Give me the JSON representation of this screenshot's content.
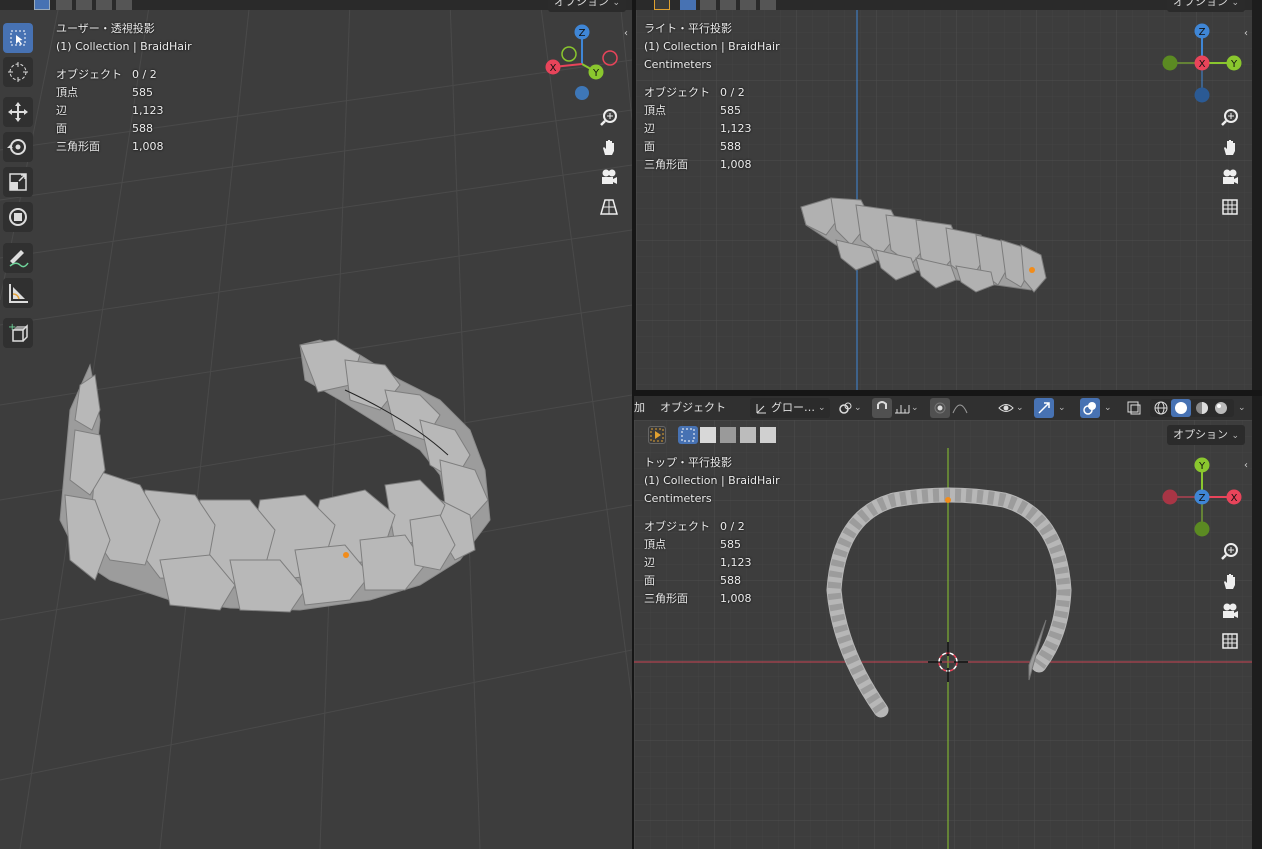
{
  "viewport_left": {
    "view_name": "ユーザー・透視投影",
    "collection": "(1) Collection | BraidHair",
    "options_label": "オプション"
  },
  "viewport_right_top": {
    "view_name": "ライト・平行投影",
    "collection": "(1) Collection | BraidHair",
    "units": "Centimeters",
    "options_label": "オプション"
  },
  "viewport_right_bottom": {
    "view_name": "トップ・平行投影",
    "collection": "(1) Collection | BraidHair",
    "units": "Centimeters",
    "options_label": "オプション"
  },
  "stats": {
    "objects_label": "オブジェクト",
    "objects_value": "0 / 2",
    "vertices_label": "頂点",
    "vertices_value": "585",
    "edges_label": "辺",
    "edges_value": "1,123",
    "faces_label": "面",
    "faces_value": "588",
    "triangles_label": "三角形面",
    "triangles_value": "1,008"
  },
  "header": {
    "add_menu": "加",
    "object_menu": "オブジェクト",
    "transform_orientation": "グロー…"
  },
  "gizmo": {
    "x": "X",
    "y": "Y",
    "z": "Z"
  },
  "colors": {
    "x_axis": "#e8445a",
    "y_axis": "#8ac72e",
    "z_axis": "#3f86d6",
    "active_tool": "#4772b3",
    "origin": "#f28c1a"
  },
  "icons": {
    "tools": [
      "select-box-icon",
      "cursor-icon",
      "move-icon",
      "rotate-icon",
      "scale-icon",
      "transform-icon",
      "annotate-icon",
      "measure-icon",
      "add-cube-icon"
    ],
    "nav": [
      "zoom-icon",
      "hand-icon",
      "camera-icon",
      "grid-icon"
    ]
  }
}
